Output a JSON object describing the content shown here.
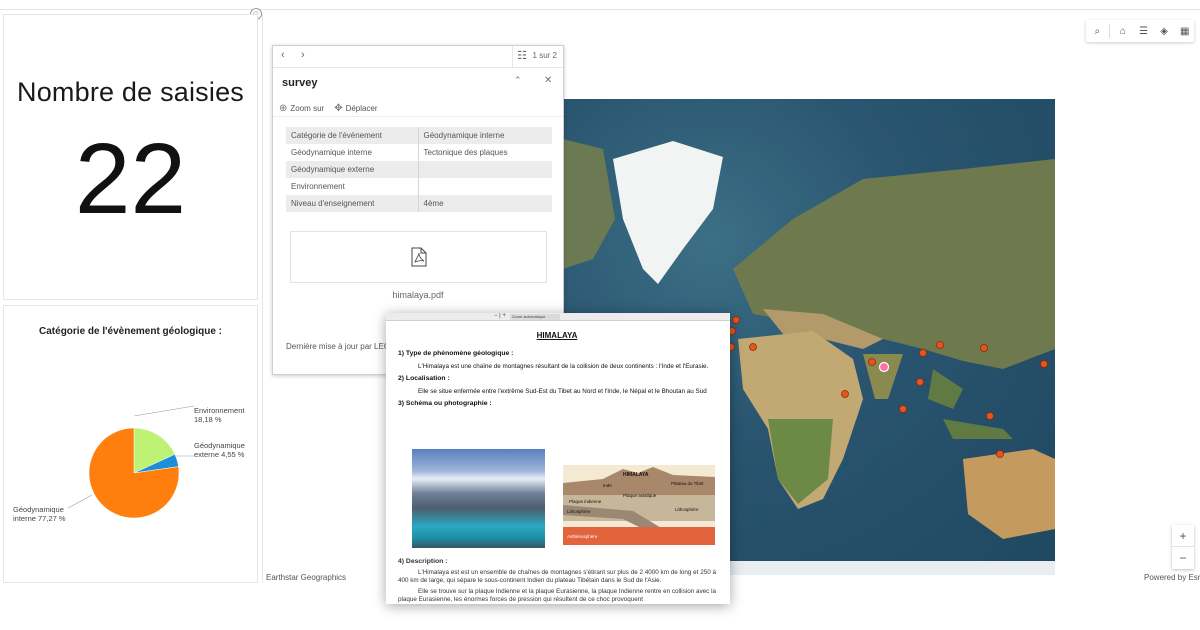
{
  "indicator": {
    "title": "Nombre de saisies",
    "value": "22"
  },
  "chart_data": {
    "type": "pie",
    "title": "Catégorie de l'évènement géologique :",
    "categories": [
      "Géodynamique interne",
      "Environnement",
      "Géodynamique externe"
    ],
    "values": [
      77.27,
      18.18,
      4.55
    ],
    "colors": [
      "#ff7f0e",
      "#bdf274",
      "#1f8ed8"
    ],
    "labels": {
      "interne": [
        "Géodynamique",
        "interne 77,27 %"
      ],
      "environnement": [
        "Environnement",
        "18,18 %"
      ],
      "externe": [
        "Géodynamique",
        "externe 4,55 %"
      ]
    }
  },
  "map": {
    "attribution_left": "Earthstar Geographics",
    "attribution_right": "Powered by Esri",
    "zoom_in": "+",
    "zoom_out": "−",
    "toolbar_icons": [
      "search-icon",
      "home-icon",
      "legend-icon",
      "layers-icon",
      "qr-code-icon"
    ]
  },
  "popup": {
    "title": "survey",
    "count": "1 sur 2",
    "zoom_label": "Zoom sur",
    "move_label": "Déplacer",
    "fields": [
      {
        "key": "Catégorie de l'évènement",
        "value": "Géodynamique interne"
      },
      {
        "key": "Géodynamique interne",
        "value": "Tectonique des plaques"
      },
      {
        "key": "Géodynamique externe",
        "value": ""
      },
      {
        "key": "Environnement",
        "value": ""
      },
      {
        "key": "Niveau d'enseignement",
        "value": "4ème"
      }
    ],
    "attachment_name": "himalaya.pdf",
    "last_update": "Dernière mise à jour par LEG"
  },
  "document": {
    "zoom_select": "Zoom automatique",
    "title": "HIMALAYA",
    "s1_heading": "1) Type de phénomène géologique :",
    "s1_text": "L'Himalaya est une chaîne de montagnes résultant de la collision de deux continents : l'Inde et l'Eurasie.",
    "s2_heading": "2) Localisation :",
    "s2_text": "Elle se situe enfermée entre l'extrême Sud-Est du Tibet au Nord et l'Inde, le Népal et le Bhoutan au Sud",
    "s3_heading": "3) Schéma ou photographie :",
    "diagram_labels": {
      "himalaya": "HIMALAYA",
      "inde": "Inde",
      "plateau": "Plateau du Tibet",
      "plaque_indienne": "Plaque indienne",
      "plaque_asiatique": "Plaque asiatique",
      "lithosphere_left": "Lithosphère",
      "lithosphere_right": "Lithosphère",
      "asthenosphere": "Asthénosphère"
    },
    "s4_heading": "4) Description :",
    "s4_text_1": "L'Himalaya est est un ensemble de chaînes de montagnes s'étirant sur plus de 2 4000 km de long et 250 à 400 km de large, qui sépare le sous-continent Indien du plateau Tibétain dans le Sud de l'Asie.",
    "s4_text_2": "Elle se trouve sur la plaque Indienne et la plaque Eurasienne, la plaque Indienne rentre en collision avec la plaque Eurasienne, les énormes forces de pression qui résultent de ce choc provoquent"
  }
}
